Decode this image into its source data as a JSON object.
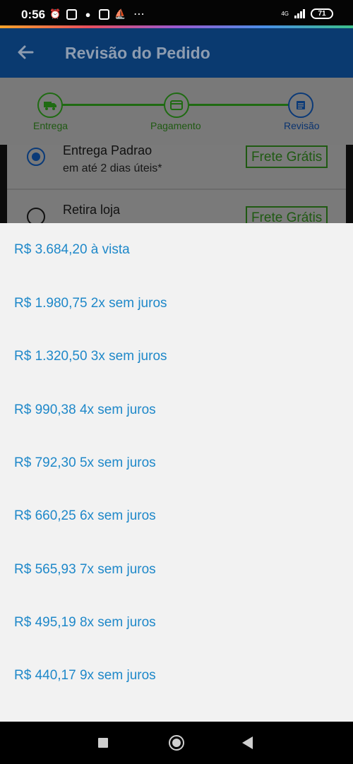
{
  "status_bar": {
    "time": "0:56",
    "network": "4G",
    "battery": "71"
  },
  "header": {
    "title": "Revisão do Pedido"
  },
  "steps": [
    {
      "label": "Entrega"
    },
    {
      "label": "Pagamento"
    },
    {
      "label": "Revisão"
    }
  ],
  "shipping": {
    "options": [
      {
        "title": "Entrega Padrao",
        "subtitle": "em até 2 dias úteis*",
        "badge": "Frete Grátis",
        "selected": true
      },
      {
        "title": "Retira loja",
        "badge": "Frete Grátis",
        "selected": false
      }
    ]
  },
  "installments": {
    "options": [
      {
        "label": "R$ 3.684,20 à vista"
      },
      {
        "label": "R$ 1.980,75 2x sem juros"
      },
      {
        "label": "R$ 1.320,50 3x sem juros"
      },
      {
        "label": "R$ 990,38 4x sem juros"
      },
      {
        "label": "R$ 792,30 5x sem juros"
      },
      {
        "label": "R$ 660,25 6x sem juros"
      },
      {
        "label": "R$ 565,93 7x sem juros"
      },
      {
        "label": "R$ 495,19 8x sem juros"
      },
      {
        "label": "R$ 440,17 9x sem juros"
      }
    ]
  },
  "colors": {
    "link_blue": "#1e88c9",
    "app_bar": "#0a3a70",
    "success_green": "#1f5a12"
  }
}
